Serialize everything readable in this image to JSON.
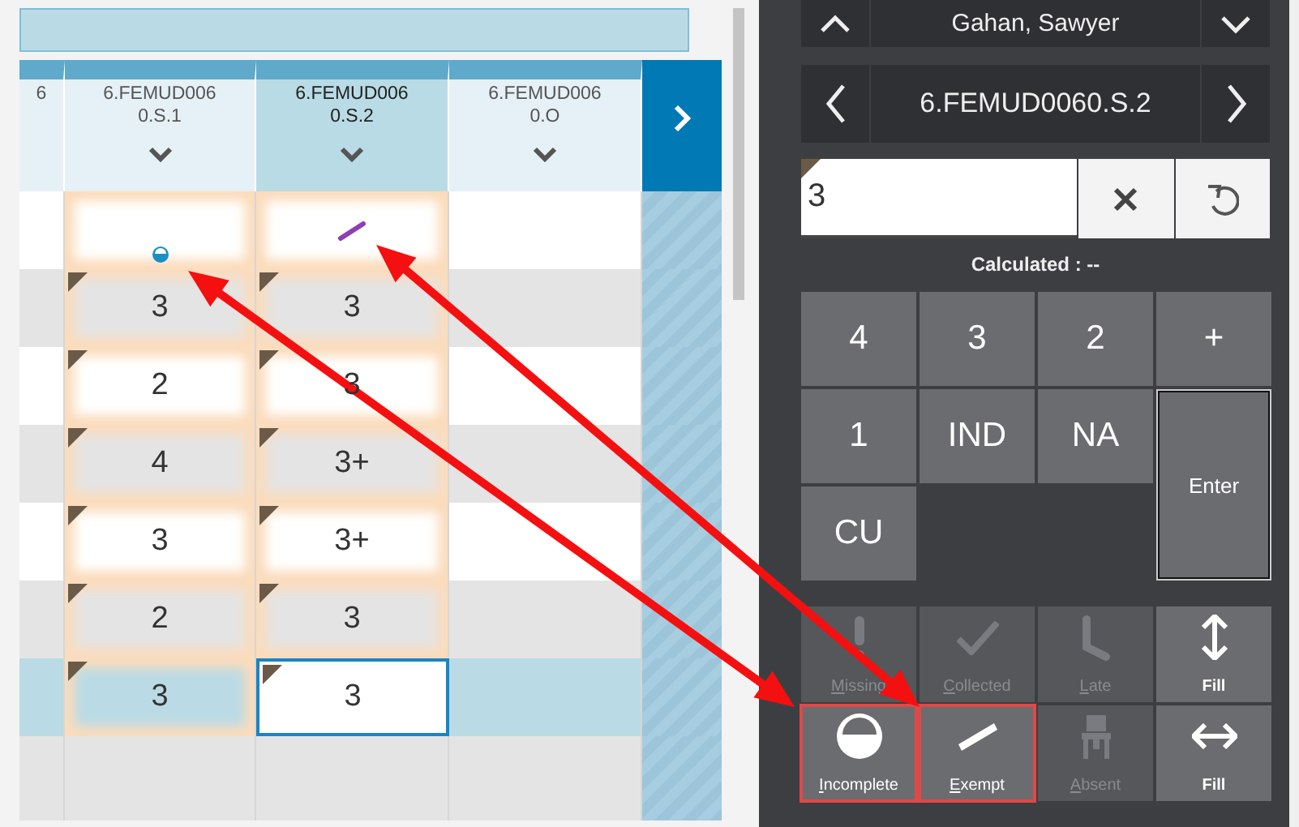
{
  "grid": {
    "columns": [
      {
        "title": "6",
        "selected": false
      },
      {
        "title": "6.FEMUD006\n0.S.1",
        "selected": false
      },
      {
        "title": "6.FEMUD006\n0.S.2",
        "selected": true
      },
      {
        "title": "6.FEMUD006\n0.O",
        "selected": false
      }
    ],
    "rows": [
      {
        "selected": false,
        "cells": [
          {
            "kind": "empty"
          },
          {
            "kind": "incomplete",
            "modified": true,
            "flagged": false,
            "editing": false
          },
          {
            "kind": "exempt",
            "modified": true,
            "flagged": false,
            "editing": false
          },
          {
            "kind": "empty"
          }
        ]
      },
      {
        "selected": false,
        "cells": [
          {
            "kind": "empty"
          },
          {
            "kind": "score",
            "value": "3",
            "modified": true,
            "flagged": true,
            "editing": false
          },
          {
            "kind": "score",
            "value": "3",
            "modified": true,
            "flagged": true,
            "editing": false
          },
          {
            "kind": "empty"
          }
        ]
      },
      {
        "selected": false,
        "cells": [
          {
            "kind": "empty"
          },
          {
            "kind": "score",
            "value": "2",
            "modified": true,
            "flagged": true,
            "editing": false
          },
          {
            "kind": "score",
            "value": "3",
            "modified": true,
            "flagged": true,
            "editing": false
          },
          {
            "kind": "empty"
          }
        ]
      },
      {
        "selected": false,
        "cells": [
          {
            "kind": "empty"
          },
          {
            "kind": "score",
            "value": "4",
            "modified": true,
            "flagged": true,
            "editing": false
          },
          {
            "kind": "score",
            "value": "3+",
            "modified": true,
            "flagged": true,
            "editing": false
          },
          {
            "kind": "empty"
          }
        ]
      },
      {
        "selected": false,
        "cells": [
          {
            "kind": "empty"
          },
          {
            "kind": "score",
            "value": "3",
            "modified": true,
            "flagged": true,
            "editing": false
          },
          {
            "kind": "score",
            "value": "3+",
            "modified": true,
            "flagged": true,
            "editing": false
          },
          {
            "kind": "empty"
          }
        ]
      },
      {
        "selected": false,
        "cells": [
          {
            "kind": "empty"
          },
          {
            "kind": "score",
            "value": "2",
            "modified": true,
            "flagged": true,
            "editing": false
          },
          {
            "kind": "score",
            "value": "3",
            "modified": true,
            "flagged": true,
            "editing": false
          },
          {
            "kind": "empty"
          }
        ]
      },
      {
        "selected": true,
        "cells": [
          {
            "kind": "empty"
          },
          {
            "kind": "score",
            "value": "3",
            "modified": true,
            "flagged": true,
            "editing": false
          },
          {
            "kind": "score",
            "value": "3",
            "modified": false,
            "flagged": true,
            "editing": true
          },
          {
            "kind": "empty"
          }
        ]
      },
      {
        "selected": false,
        "cells": [
          {
            "kind": "empty"
          },
          {
            "kind": "empty"
          },
          {
            "kind": "empty"
          },
          {
            "kind": "empty"
          }
        ]
      }
    ]
  },
  "panel": {
    "student": {
      "name": "Gahan, Sawyer"
    },
    "column_nav": {
      "title": "6.FEMUD0060.S.2"
    },
    "score_input": {
      "value": "3",
      "flagged": true
    },
    "calculated": "Calculated : --",
    "keypad": [
      {
        "kind": "key",
        "label": "4"
      },
      {
        "kind": "key",
        "label": "3"
      },
      {
        "kind": "key",
        "label": "2"
      },
      {
        "kind": "key",
        "label": "+"
      },
      {
        "kind": "key",
        "label": "1"
      },
      {
        "kind": "key",
        "label": "IND"
      },
      {
        "kind": "key",
        "label": "NA"
      },
      {
        "kind": "enter",
        "label": "Enter"
      },
      {
        "kind": "key",
        "label": "CU"
      }
    ],
    "status_buttons": [
      {
        "kind": "missing",
        "label": "Missing",
        "disabled": true,
        "highlighted": false
      },
      {
        "kind": "collected",
        "label": "Collected",
        "disabled": true,
        "highlighted": false
      },
      {
        "kind": "late",
        "label": "Late",
        "disabled": true,
        "highlighted": false
      },
      {
        "kind": "fillvertical",
        "label": "Fill",
        "disabled": false,
        "highlighted": false
      },
      {
        "kind": "incomplete",
        "label": "Incomplete",
        "disabled": false,
        "highlighted": true
      },
      {
        "kind": "exempt",
        "label": "Exempt",
        "disabled": false,
        "highlighted": true
      },
      {
        "kind": "absent",
        "label": "Absent",
        "disabled": true,
        "highlighted": false
      },
      {
        "kind": "fillhorizontal",
        "label": "Fill",
        "disabled": false,
        "highlighted": false
      }
    ]
  }
}
